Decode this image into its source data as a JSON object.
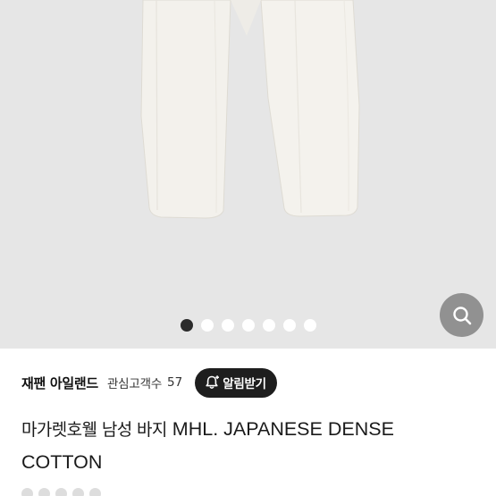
{
  "gallery": {
    "image_count": 7,
    "active_index": 0,
    "zoom_icon": "search-icon"
  },
  "seller": {
    "name": "재팬 아일랜드",
    "follow_label": "관심고객수",
    "follow_count": "57"
  },
  "alarm_button": {
    "label": "알림받기",
    "icon": "bell-plus-icon"
  },
  "product": {
    "title_ko": "마가렛호웰 남성 바지",
    "title_en": "MHL. JAPANESE DENSE COTTON"
  },
  "colors": {
    "image_bg": "#e6e6e6",
    "accent_dark": "#1e1e1e",
    "zoom_bg": "#787878"
  }
}
